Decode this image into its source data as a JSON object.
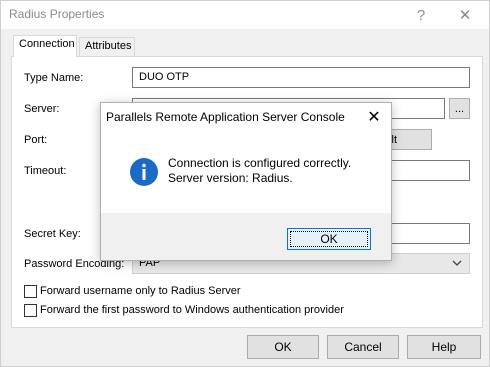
{
  "window": {
    "title": "Radius Properties",
    "help_glyph": "?",
    "close_glyph": "✕"
  },
  "tabs": [
    {
      "label": "Connection",
      "active": true
    },
    {
      "label": "Attributes",
      "active": false
    }
  ],
  "form": {
    "type_name_label": "Type Name:",
    "type_name_value": "DUO OTP",
    "server_label": "Server:",
    "server_browse": "...",
    "port_label": "Port:",
    "port_default_partial": "lt",
    "timeout_label": "Timeout:",
    "secret_key_label": "Secret Key:",
    "password_encoding_label": "Password Encoding:",
    "password_encoding_value": "PAP",
    "forward_username_label": "Forward username only to Radius Server",
    "forward_password_label": "Forward the first password to Windows authentication provider"
  },
  "buttons": {
    "ok": "OK",
    "cancel": "Cancel",
    "help": "Help"
  },
  "modal": {
    "title": "Parallels Remote Application Server Console",
    "close_glyph": "✕",
    "message_line1": "Connection is configured correctly.",
    "message_line2": "Server version: Radius.",
    "ok": "OK",
    "icon": "info-icon",
    "icon_color": "#1a6bc7"
  }
}
